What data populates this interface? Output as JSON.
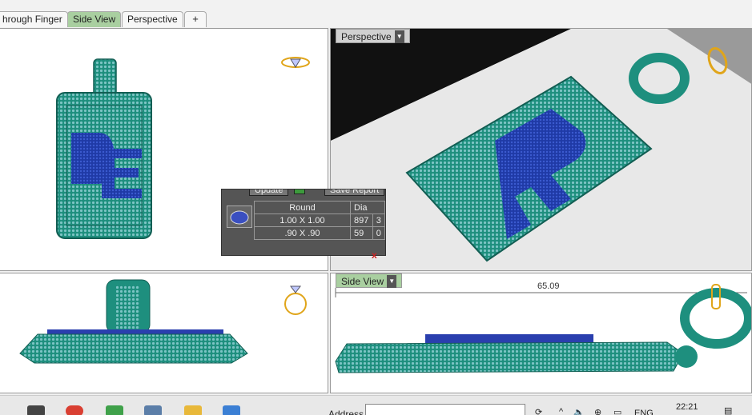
{
  "tabs": [
    {
      "label": "hrough Finger",
      "active": false
    },
    {
      "label": "Side View",
      "active": true
    },
    {
      "label": "Perspective",
      "active": false
    }
  ],
  "add_tab_label": "+",
  "viewports": {
    "front": {
      "label": ""
    },
    "perspective": {
      "label": "Perspective"
    },
    "top": {
      "label": ""
    },
    "side": {
      "label": "Side View",
      "dimension": "65.09"
    }
  },
  "report": {
    "buttons": [
      "Update",
      "Save Report"
    ],
    "headers": [
      "Round",
      "Dia"
    ],
    "rows": [
      {
        "size": "1.00 X 1.00",
        "count": "897",
        "extra": "3"
      },
      {
        "size": ".90 X .90",
        "count": "59",
        "extra": "0"
      }
    ],
    "close_label": "x"
  },
  "taskbar": {
    "address_label": "Address",
    "language": "ENG",
    "time": "22:21"
  },
  "colors": {
    "tab_active": "#a9cfa0",
    "metal": "#1e8f7e",
    "stone_blue": "#2a3fae",
    "stone_light": "#7cc4c4",
    "gold": "#e0a51a"
  }
}
